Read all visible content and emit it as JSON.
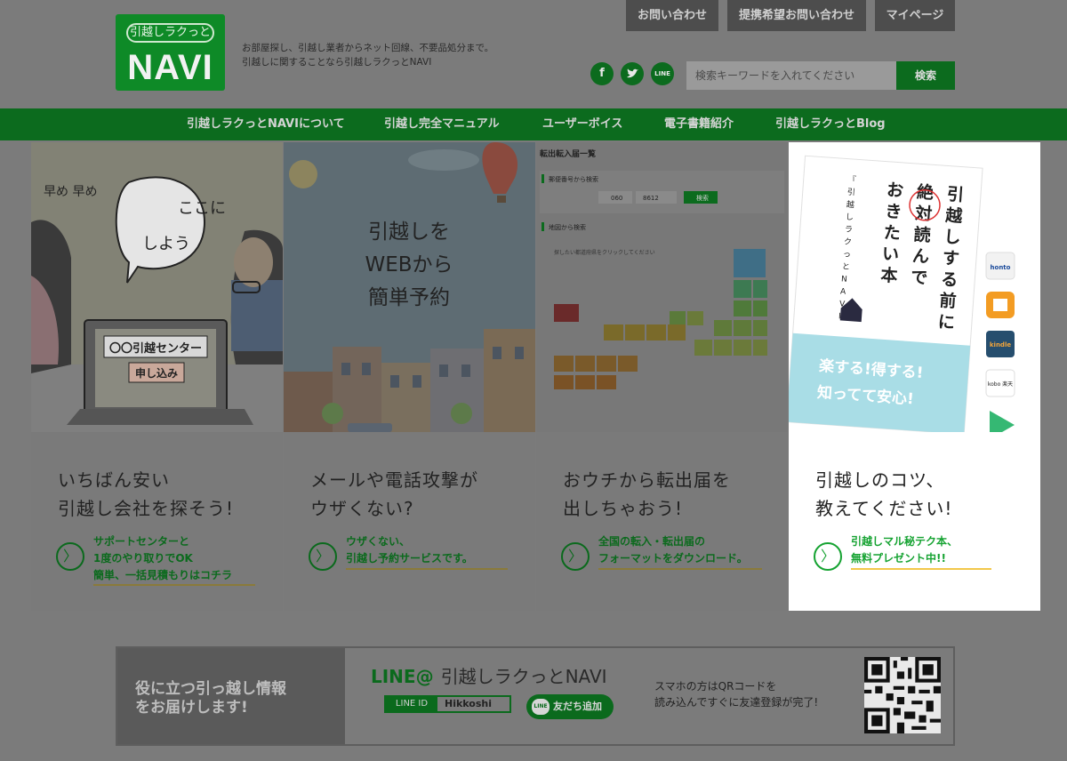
{
  "header": {
    "logo_top": "引越しラクっと",
    "logo_big": "NAVI",
    "tagline_line1": "お部屋探し、引越し業者からネット回線、不要品処分まで。",
    "tagline_line2": "引越しに関することなら引越しラクっとNAVI",
    "top_buttons": [
      "お問い合わせ",
      "提携希望お問い合わせ",
      "マイページ"
    ],
    "social": {
      "facebook": "f",
      "line": "LINE"
    },
    "search_placeholder": "検索キーワードを入れてください",
    "search_button": "検索"
  },
  "nav": [
    "引越しラクっとNAVIについて",
    "引越し完全マニュアル",
    "ユーザーボイス",
    "電子書籍紹介",
    "引越しラクっとBlog"
  ],
  "cards": [
    {
      "illustration_text": {
        "bubble": "ここにしよう",
        "hayame": "早め 早め",
        "screen_title": "〇〇引越センター",
        "screen_button": "申し込み"
      },
      "heading_line1": "いちばん安い",
      "heading_line2": "引越し会社を探そう!",
      "link_lines": [
        "サポートセンターと",
        "1度のやり取りでOK",
        "簡単、一括見積もりはコチラ"
      ]
    },
    {
      "illustration_text": {
        "line1": "引越しを",
        "line2": "WEBから",
        "line3": "簡単予約"
      },
      "heading_line1": "メールや電話攻撃が",
      "heading_line2": "ウザくない?",
      "link_lines": [
        "ウザくない、",
        "引越し予約サービスです。"
      ]
    },
    {
      "illustration_text": {
        "title": "転出転入届一覧",
        "postal_label": "郵便番号から検索",
        "postal_a": "060",
        "postal_b": "8612",
        "search_btn": "検索",
        "map_label": "地図から検索",
        "map_hint": "探したい都道府県をクリックしてください"
      },
      "heading_line1": "おウチから転出届を",
      "heading_line2": "出しちゃおう!",
      "link_lines": [
        "全国の転入・転出届の",
        "フォーマットをダウンロード。"
      ]
    },
    {
      "illustration_text": {
        "book_title": "引越しする前に絶対読んでおきたい本",
        "book_sub": "『引越しラクっとNAVI』特別調査隊 著",
        "book_band": "楽する!得する!知ってて安心!",
        "stores": [
          "honto",
          "kindle",
          "kobo 楽天"
        ]
      },
      "heading_line1": "引越しのコツ、",
      "heading_line2": "教えてください!",
      "link_lines": [
        "引越しマル秘テク本、",
        "無料プレゼント中!!"
      ]
    }
  ],
  "line_banner": {
    "left_line1": "役に立つ引っ越し情報",
    "left_line2": "をお届けします!",
    "title_prefix": "LINE@",
    "title_name": "引越しラクっとNAVI",
    "id_label": "LINE ID",
    "id_value": "Hikkoshi",
    "add_button": "友だち追加",
    "add_badge": "LINE",
    "note_line1": "スマホの方はQRコードを",
    "note_line2": "読み込んですぐに友達登録が完了!"
  },
  "colors": {
    "brand_green": "#16a332",
    "overlay_green": "#0c6b1e",
    "accent_yellow": "#f2c84a"
  }
}
